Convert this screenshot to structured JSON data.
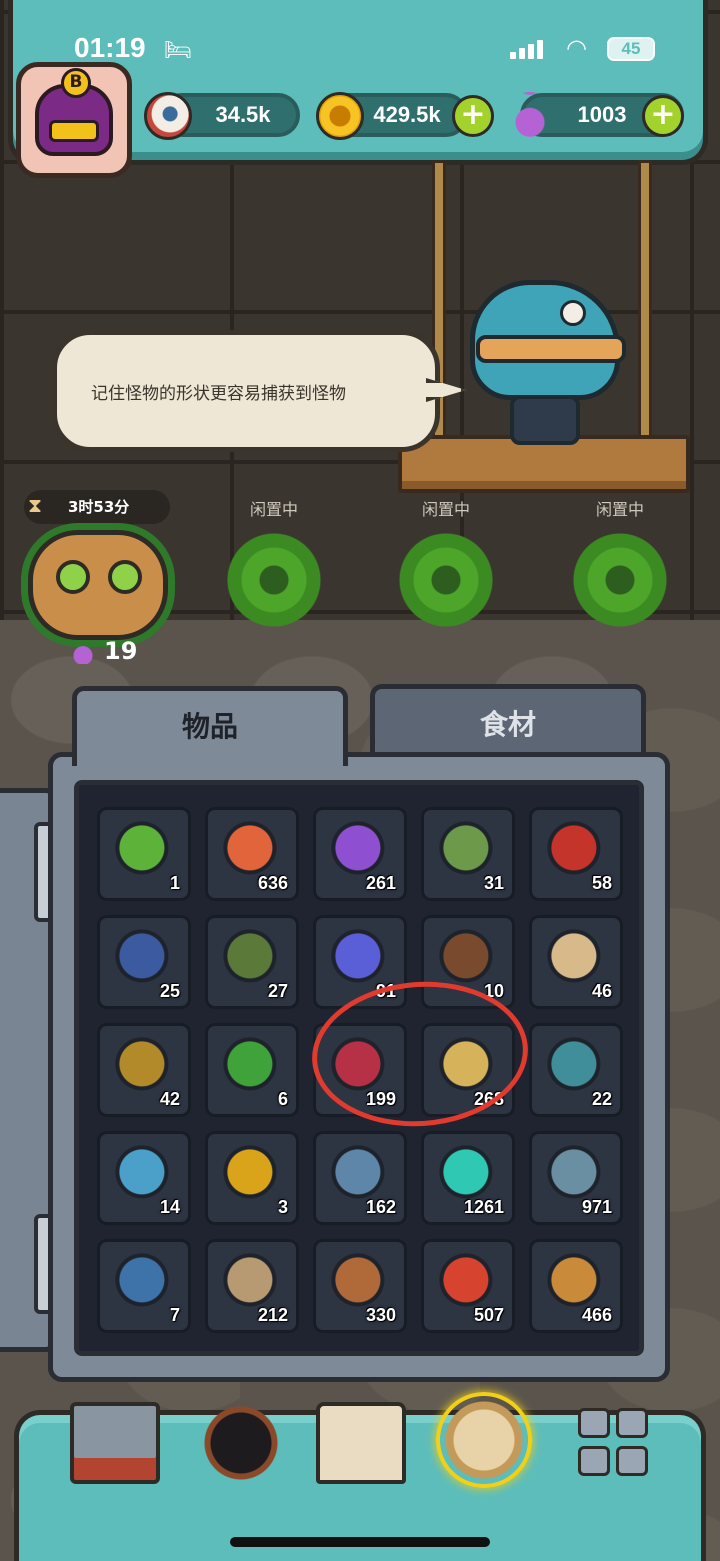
{
  "status_bar": {
    "time": "01:19",
    "battery": "45"
  },
  "resources": {
    "eyeballs": "34.5k",
    "coins": "429.5k",
    "potions": "1003"
  },
  "speech": {
    "text": "记住怪物的形状更容易捕获到怪物"
  },
  "slots": {
    "timer": "3时53分",
    "potion_count": "19",
    "idle_label": "闲置中"
  },
  "tabs": {
    "items": "物品",
    "food": "食材"
  },
  "inventory": [
    {
      "icon": "green-bottle-icon",
      "qty": "1"
    },
    {
      "icon": "meat-icon",
      "qty": "636"
    },
    {
      "icon": "purple-powder-icon",
      "qty": "261"
    },
    {
      "icon": "card-map-icon",
      "qty": "31"
    },
    {
      "icon": "red-barrel-icon",
      "qty": "58"
    },
    {
      "icon": "monster-card-icon",
      "qty": "25"
    },
    {
      "icon": "cauldron-card-icon",
      "qty": "27"
    },
    {
      "icon": "crystal-icon",
      "qty": "91"
    },
    {
      "icon": "slime-pot-icon",
      "qty": "10"
    },
    {
      "icon": "treasure-map-icon",
      "qty": "46"
    },
    {
      "icon": "picture-frame-icon",
      "qty": "42"
    },
    {
      "icon": "four-leaf-clover-icon",
      "qty": "6"
    },
    {
      "icon": "wizard-hat-icon",
      "qty": "199"
    },
    {
      "icon": "gold-coin-pile-icon",
      "qty": "268"
    },
    {
      "icon": "soot-ring-icon",
      "qty": "22"
    },
    {
      "icon": "puzzle-piece-icon",
      "qty": "14"
    },
    {
      "icon": "gold-pentagon-icon",
      "qty": "3"
    },
    {
      "icon": "mechanical-part-icon",
      "qty": "162"
    },
    {
      "icon": "ghost-crab-icon",
      "qty": "1261"
    },
    {
      "icon": "soot-necklace-icon",
      "qty": "971"
    },
    {
      "icon": "soot-can-icon",
      "qty": "7"
    },
    {
      "icon": "rope-icon",
      "qty": "212"
    },
    {
      "icon": "mallet-icon",
      "qty": "330"
    },
    {
      "icon": "sea-urchin-icon",
      "qty": "507"
    },
    {
      "icon": "feather-icon",
      "qty": "466"
    }
  ],
  "nav": [
    "shop-icon",
    "monster-icon",
    "book-icon",
    "bag-icon",
    "menu-grid-icon"
  ],
  "colors": {
    "accent_teal": "#5cbdbb",
    "plus_green": "#a4d22d",
    "annotation_red": "#e03b2e"
  }
}
